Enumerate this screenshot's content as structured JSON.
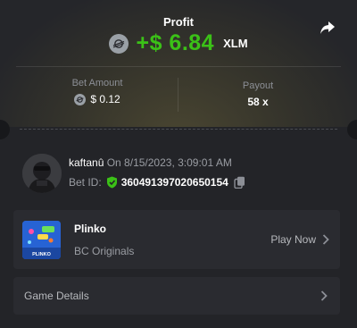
{
  "header": {
    "profit_label": "Profit",
    "profit_value": "+$ 6.84",
    "currency": "XLM",
    "coin_icon": "stellar-coin-icon",
    "share_icon": "share-icon"
  },
  "bet_info": {
    "bet_amount_label": "Bet Amount",
    "bet_amount_value": "$ 0.12",
    "payout_label": "Payout",
    "payout_value": "58 x"
  },
  "user": {
    "username": "kaftanû",
    "date_text": "On 8/15/2023, 3:09:01 AM",
    "bet_id_label": "Bet ID:",
    "bet_id": "360491397020650154"
  },
  "game": {
    "name": "Plinko",
    "provider": "BC Originals",
    "play_label": "Play Now",
    "thumb_text": "PLINKO"
  },
  "details": {
    "label": "Game Details"
  },
  "colors": {
    "profit_green": "#3bc117",
    "background": "#232428",
    "panel": "#2a2b30"
  }
}
